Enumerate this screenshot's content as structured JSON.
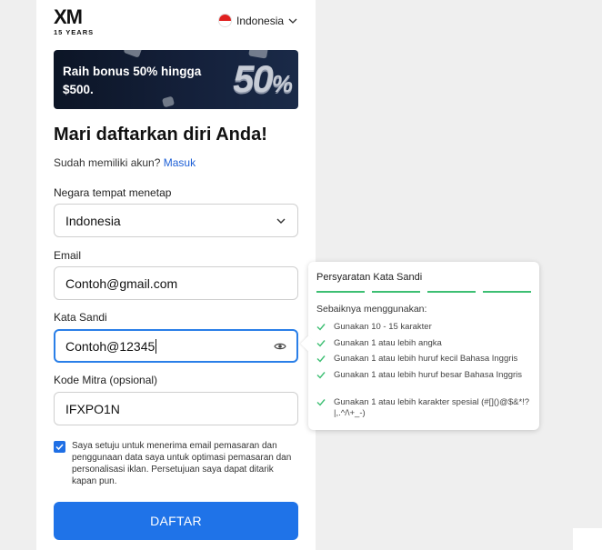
{
  "header": {
    "logo_text": "XM",
    "logo_sub": "15 YEARS",
    "language": "Indonesia"
  },
  "banner": {
    "text": "Raih bonus 50% hingga $500.",
    "big_number": "50",
    "big_percent": "%"
  },
  "form": {
    "title": "Mari daftarkan diri Anda!",
    "have_account": "Sudah memiliki akun?",
    "login_link": "Masuk",
    "country_label": "Negara tempat menetap",
    "country_value": "Indonesia",
    "email_label": "Email",
    "email_value": "Contoh@gmail.com",
    "password_label": "Kata Sandi",
    "password_value": "Contoh@12345",
    "partner_label": "Kode Mitra (opsional)",
    "partner_value": "IFXPO1N",
    "consent_text": "Saya setuju untuk menerima email pemasaran dan penggunaan data saya untuk optimasi pemasaran dan personalisasi iklan. Persetujuan saya dapat ditarik kapan pun.",
    "consent_checked": true,
    "submit_label": "DAFTAR"
  },
  "password_popover": {
    "title": "Persyaratan Kata Sandi",
    "strength_bars": 4,
    "strength_color": "#3dbf73",
    "subtitle": "Sebaiknya menggunakan:",
    "requirements": [
      "Gunakan 10 - 15 karakter",
      "Gunakan 1 atau lebih angka",
      "Gunakan 1 atau lebih huruf kecil Bahasa Inggris",
      "Gunakan 1 atau lebih huruf besar Bahasa Inggris",
      "Gunakan 1 atau lebih karakter spesial (#[]()@$&*!?|,.^/\\+_-)"
    ]
  },
  "colors": {
    "primary": "#1f73e8",
    "focus_border": "#2a7fe8",
    "link": "#1d5fd6",
    "check_green": "#3dbf73"
  }
}
